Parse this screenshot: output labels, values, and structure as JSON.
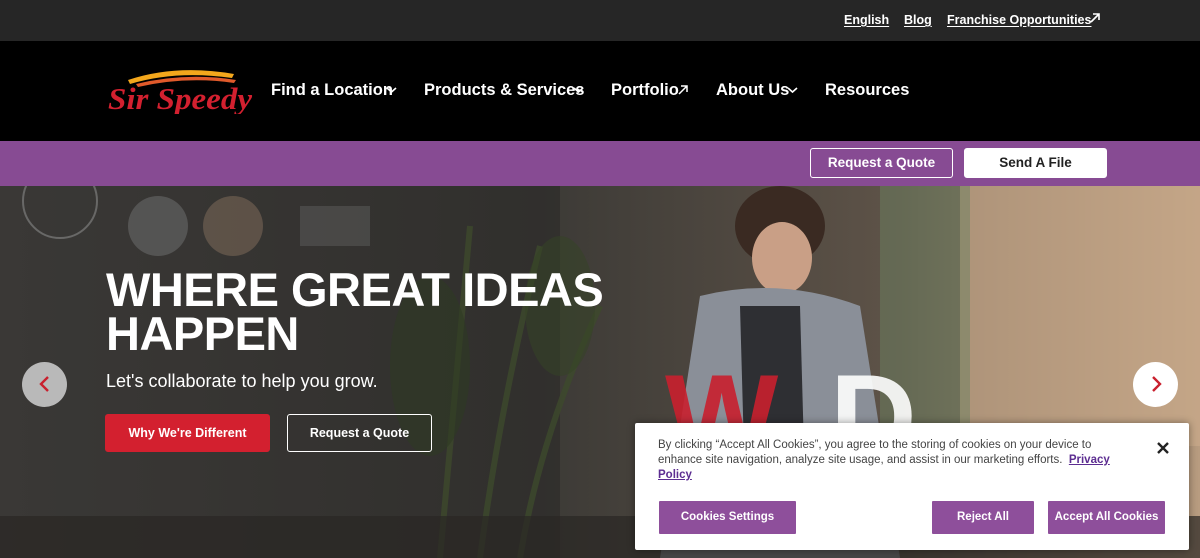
{
  "utility": {
    "english": "English",
    "blog": "Blog",
    "franchise": "Franchise Opportunities"
  },
  "logo": {
    "text": "Sir Speedy"
  },
  "nav": {
    "find_location": "Find a Location",
    "products_services": "Products & Services",
    "portfolio": "Portfolio",
    "about_us": "About Us",
    "resources": "Resources"
  },
  "band": {
    "request_quote": "Request a Quote",
    "send_file": "Send A File"
  },
  "hero": {
    "title_line1": "WHERE GREAT IDEAS",
    "title_line2": "HAPPEN",
    "subtitle": "Let's collaborate to help you grow.",
    "btn_primary": "Why We're Different",
    "btn_secondary": "Request a Quote"
  },
  "cookie": {
    "text": "By clicking “Accept All Cookies”, you agree to the storing of cookies on your device to enhance site navigation, analyze site usage, and assist in our marketing efforts.",
    "privacy_link": "Privacy Policy",
    "settings": "Cookies Settings",
    "reject": "Reject All",
    "accept": "Accept All Cookies"
  },
  "colors": {
    "brand_red": "#d3202f",
    "band_purple": "#8e4f9b",
    "cookie_purple": "#8e4f9b"
  },
  "icons": {
    "external": "arrow-up-right-icon",
    "dropdown": "chevron-down-icon",
    "prev": "chevron-left-icon",
    "next": "chevron-right-icon",
    "close": "close-icon"
  }
}
